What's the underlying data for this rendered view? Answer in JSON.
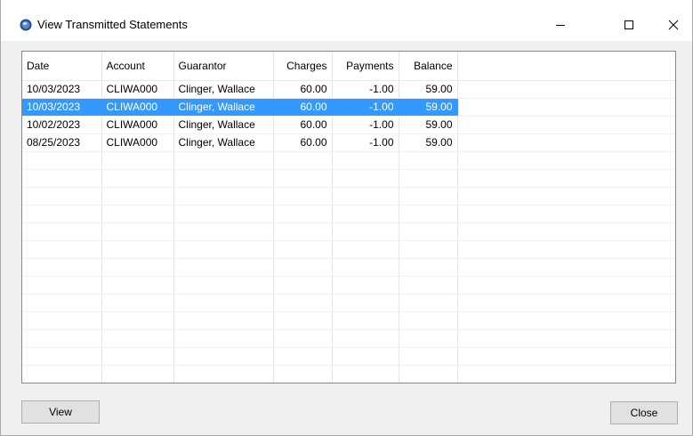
{
  "window": {
    "title": "View Transmitted Statements",
    "controls": {
      "minimize": "minimize",
      "maximize": "maximize",
      "close": "close"
    }
  },
  "grid": {
    "columns": [
      "Date",
      "Account",
      "Guarantor",
      "Charges",
      "Payments",
      "Balance"
    ],
    "rows": [
      {
        "date": "10/03/2023",
        "account": "CLIWA000",
        "guarantor": "Clinger, Wallace",
        "charges": "60.00",
        "payments": "-1.00",
        "balance": "59.00",
        "selected": false
      },
      {
        "date": "10/03/2023",
        "account": "CLIWA000",
        "guarantor": "Clinger, Wallace",
        "charges": "60.00",
        "payments": "-1.00",
        "balance": "59.00",
        "selected": true
      },
      {
        "date": "10/02/2023",
        "account": "CLIWA000",
        "guarantor": "Clinger, Wallace",
        "charges": "60.00",
        "payments": "-1.00",
        "balance": "59.00",
        "selected": false
      },
      {
        "date": "08/25/2023",
        "account": "CLIWA000",
        "guarantor": "Clinger, Wallace",
        "charges": "60.00",
        "payments": "-1.00",
        "balance": "59.00",
        "selected": false
      }
    ]
  },
  "buttons": {
    "view": "View",
    "close": "Close"
  },
  "colors": {
    "selection": "#3399ff",
    "window_bg": "#f0f0f0"
  }
}
